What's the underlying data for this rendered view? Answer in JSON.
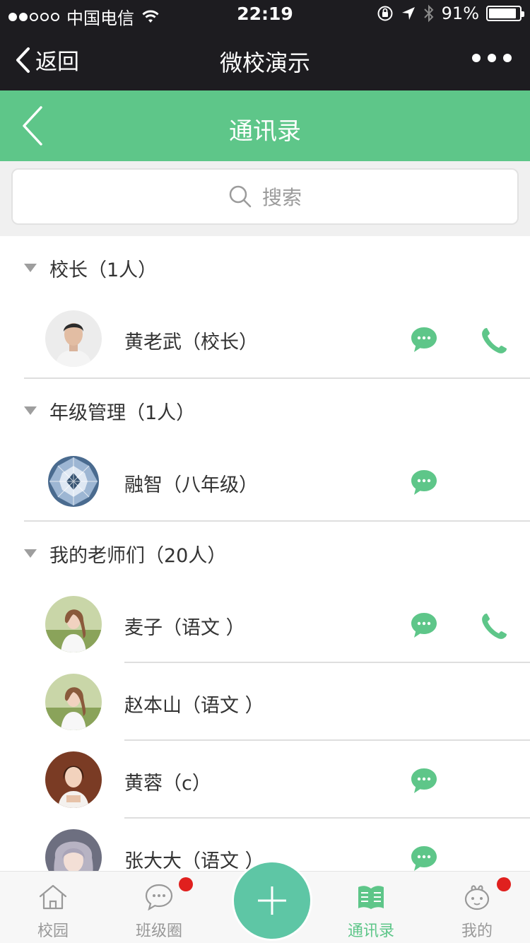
{
  "status_bar": {
    "carrier": "中国电信",
    "time": "22:19",
    "battery_percent": "91%",
    "battery_level": 0.91,
    "signal_dots_filled": 2,
    "signal_dots_total": 5
  },
  "wechat_nav": {
    "back_label": "返回",
    "title": "微校演示"
  },
  "header": {
    "title": "通讯录"
  },
  "search": {
    "placeholder": "搜索"
  },
  "groups": [
    {
      "title": "校长（1人）",
      "members": [
        {
          "name": "黄老武（校长）",
          "message": true,
          "phone": true
        }
      ]
    },
    {
      "title": "年级管理（1人）",
      "members": [
        {
          "name": "融智（八年级）",
          "message": true,
          "phone": false
        }
      ]
    },
    {
      "title": "我的老师们（20人）",
      "members": [
        {
          "name": "麦子（语文 ）",
          "message": true,
          "phone": true
        },
        {
          "name": "赵本山（语文 ）",
          "message": false,
          "phone": false
        },
        {
          "name": "黄蓉（c）",
          "message": true,
          "phone": false
        },
        {
          "name": "张大大（语文 ）",
          "message": true,
          "phone": false
        }
      ]
    }
  ],
  "tabs": [
    {
      "label": "校园",
      "icon": "home-icon",
      "badge": false
    },
    {
      "label": "班级圈",
      "icon": "chat-bubble-icon",
      "badge": true
    },
    {
      "label": "通讯录",
      "icon": "contacts-book-icon",
      "badge": false,
      "active": true
    },
    {
      "label": "我的",
      "icon": "profile-icon",
      "badge": true
    }
  ],
  "colors": {
    "accent_green": "#5ec689",
    "dark_bar": "#1d1c20",
    "badge_red": "#e0201e",
    "plus_button": "#5ec6a5"
  }
}
